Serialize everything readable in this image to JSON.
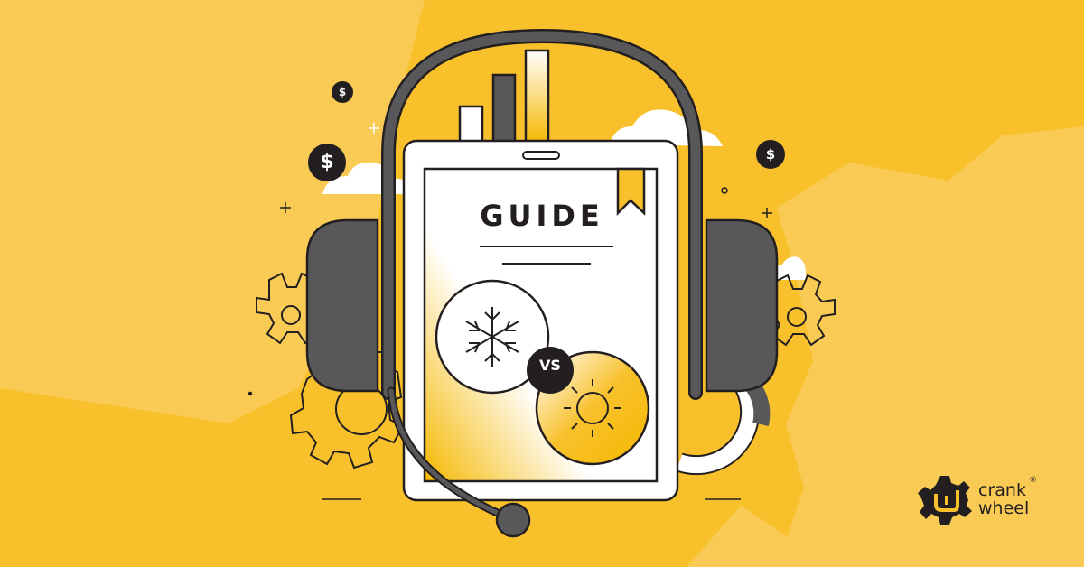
{
  "illustration": {
    "guide_title": "GUIDE",
    "versus_label": "VS",
    "currency_symbol": "$",
    "icons": [
      "headset-icon",
      "tablet-icon",
      "bookmark-icon",
      "bar-chart-icon",
      "snowflake-icon",
      "sun-icon",
      "gear-icon",
      "dollar-coin-icon",
      "cloud-icon",
      "donut-chart-icon"
    ]
  },
  "brand": {
    "name_line1": "crank",
    "name_line2": "wheel",
    "registered_mark": "®"
  },
  "colors": {
    "background": "#f8c12c",
    "background_light": "#f9cb55",
    "accent_yellow": "#f5b800",
    "outline": "#231f20",
    "headset_gray": "#58585b",
    "white": "#ffffff"
  }
}
